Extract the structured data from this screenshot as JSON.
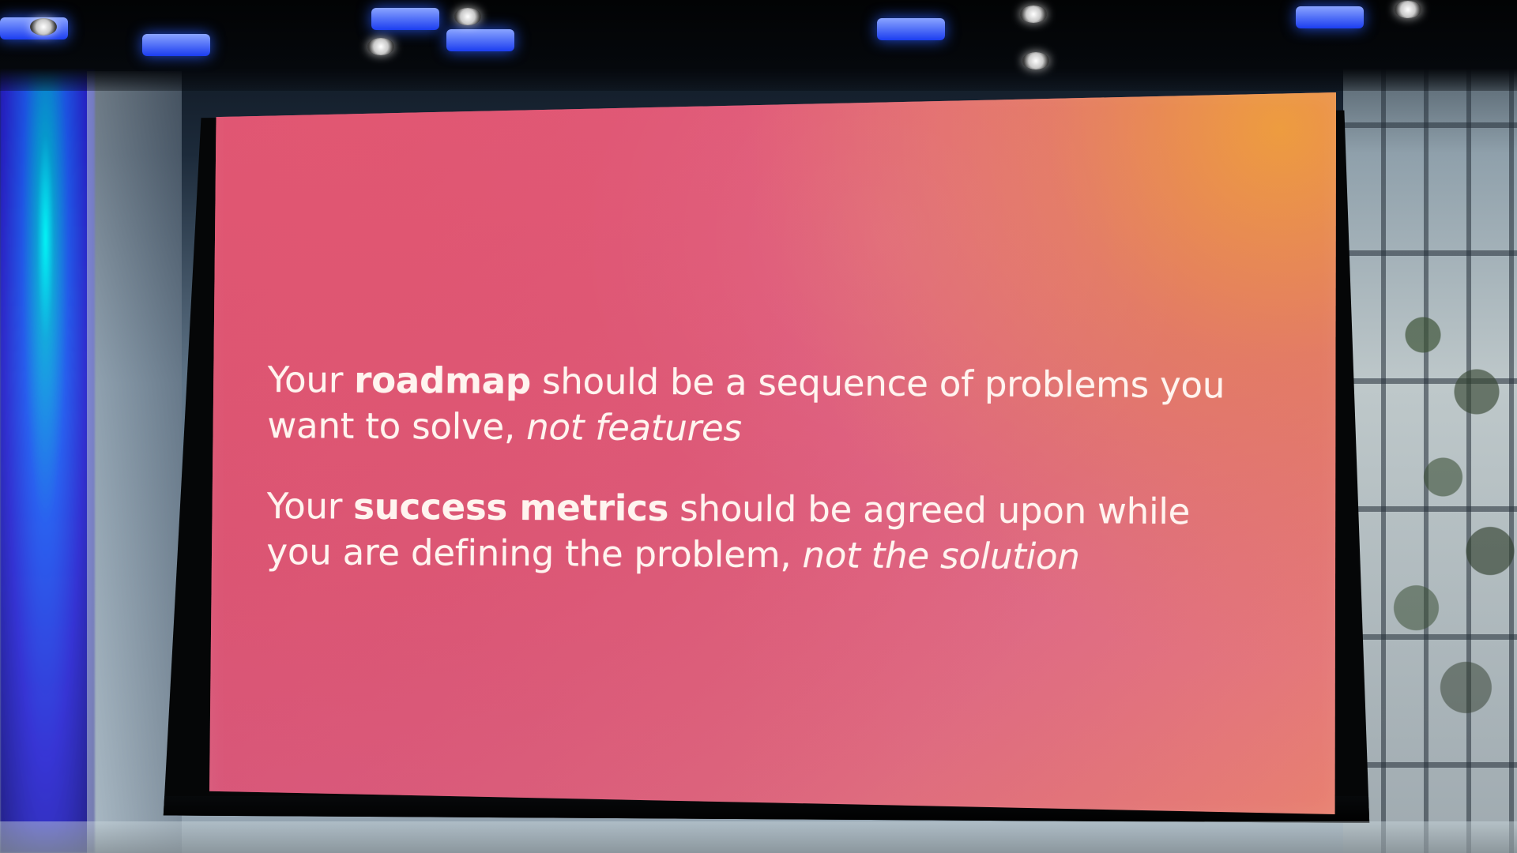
{
  "presentation": {
    "slides": [
      {
        "paragraphs": [
          {
            "parts": [
              {
                "text": "Your ",
                "style": "normal"
              },
              {
                "text": "roadmap",
                "style": "bold"
              },
              {
                "text": " should be a sequence of problems you want to solve, ",
                "style": "normal"
              },
              {
                "text": "not features",
                "style": "italic"
              }
            ]
          },
          {
            "parts": [
              {
                "text": "Your ",
                "style": "normal"
              },
              {
                "text": "success metrics",
                "style": "bold"
              },
              {
                "text": " should be agreed upon while you are defining the problem, ",
                "style": "normal"
              },
              {
                "text": "not the solution",
                "style": "italic"
              }
            ]
          }
        ]
      }
    ]
  },
  "colors": {
    "slide_primary": "#db4f78",
    "slide_secondary": "#ef8574",
    "slide_text": "#fff4ef",
    "stage_blue": "#1b3df0"
  }
}
